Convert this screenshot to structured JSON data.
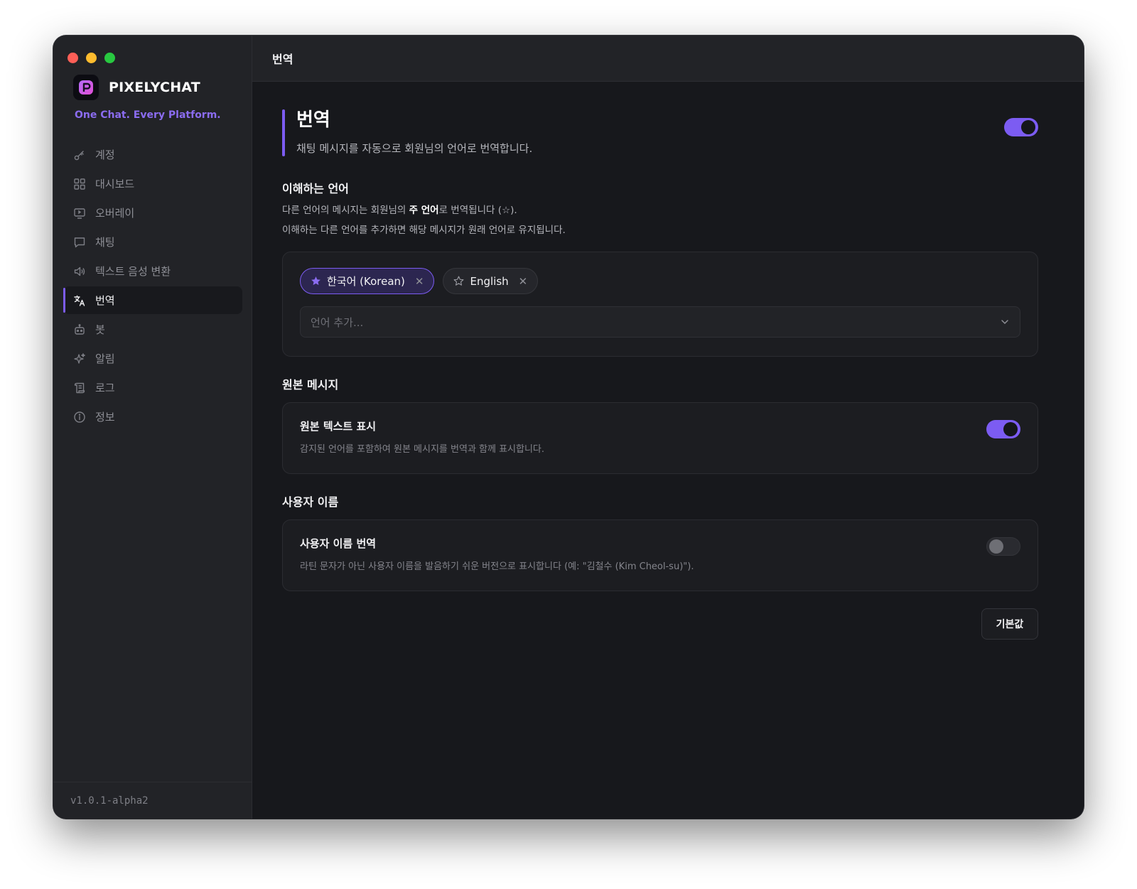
{
  "app": {
    "brand_name": "PIXELYCHAT",
    "tagline": "One Chat. Every Platform.",
    "version": "v1.0.1-alpha2",
    "accent_color": "#7c5cf2"
  },
  "sidebar": {
    "items": [
      {
        "label": "계정",
        "icon": "key-icon",
        "active": false
      },
      {
        "label": "대시보드",
        "icon": "grid-icon",
        "active": false
      },
      {
        "label": "오버레이",
        "icon": "monitor-icon",
        "active": false
      },
      {
        "label": "채팅",
        "icon": "chat-bubble-icon",
        "active": false
      },
      {
        "label": "텍스트 음성 변환",
        "icon": "speaker-icon",
        "active": false
      },
      {
        "label": "번역",
        "icon": "translate-icon",
        "active": true
      },
      {
        "label": "봇",
        "icon": "bot-icon",
        "active": false
      },
      {
        "label": "알림",
        "icon": "sparkle-icon",
        "active": false
      },
      {
        "label": "로그",
        "icon": "scroll-icon",
        "active": false
      },
      {
        "label": "정보",
        "icon": "info-icon",
        "active": false
      }
    ]
  },
  "header": {
    "title": "번역"
  },
  "translation": {
    "title": "번역",
    "description": "채팅 메시지를 자동으로 회원님의 언어로 번역합니다.",
    "enabled": true,
    "languages_section": {
      "title": "이해하는 언어",
      "desc_before": "다른 언어의 메시지는 회원님의 ",
      "desc_bold": "주 언어",
      "desc_after": "로 번역됩니다 (☆).",
      "desc_line2": "이해하는 다른 언어를 추가하면 해당 메시지가 원래 언어로 유지됩니다.",
      "chips": [
        {
          "label": "한국어 (Korean)",
          "primary": true
        },
        {
          "label": "English",
          "primary": false
        }
      ],
      "add_placeholder": "언어 추가..."
    },
    "original_section": {
      "title": "원본 메시지",
      "setting_title": "원본 텍스트 표시",
      "setting_desc": "감지된 언어를 포함하여 원본 메시지를 번역과 함께 표시합니다.",
      "enabled": true
    },
    "username_section": {
      "title": "사용자 이름",
      "setting_title": "사용자 이름 번역",
      "setting_desc": "라틴 문자가 아닌 사용자 이름을 발음하기 쉬운 버전으로 표시합니다 (예: \"김철수 (Kim Cheol-su)\").",
      "enabled": false
    },
    "default_button": "기본값"
  }
}
